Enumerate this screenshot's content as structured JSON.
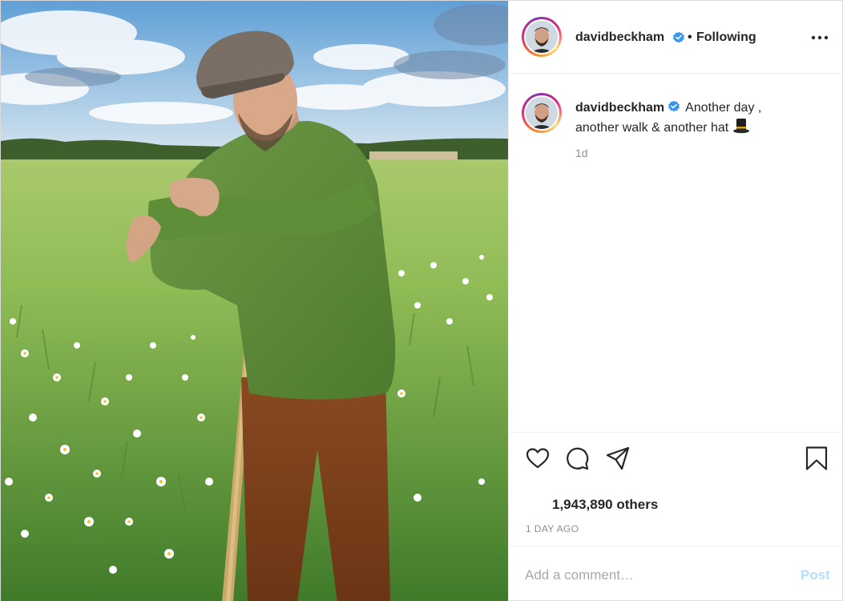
{
  "post": {
    "author": {
      "username": "davidbeckham",
      "verified": true
    },
    "header": {
      "separator": "•",
      "follow_label": "Following",
      "more_icon": "more-horizontal-icon"
    },
    "caption": {
      "text_line1": "Another day ,",
      "text_line2": "another walk & another hat",
      "emoji": "top-hat-icon",
      "time": "1d"
    },
    "actions": {
      "like_icon": "heart-icon",
      "comment_icon": "comment-icon",
      "share_icon": "share-icon",
      "save_icon": "bookmark-icon"
    },
    "likes": {
      "text": "1,943,890 others"
    },
    "timestamp": "1 DAY AGO",
    "comment_box": {
      "placeholder": "Add a comment…",
      "post_label": "Post"
    },
    "colors": {
      "verified_blue": "#3897f0",
      "post_button_disabled": "#b2dffc",
      "muted_text": "#8e8e8e",
      "divider": "#efefef"
    }
  }
}
